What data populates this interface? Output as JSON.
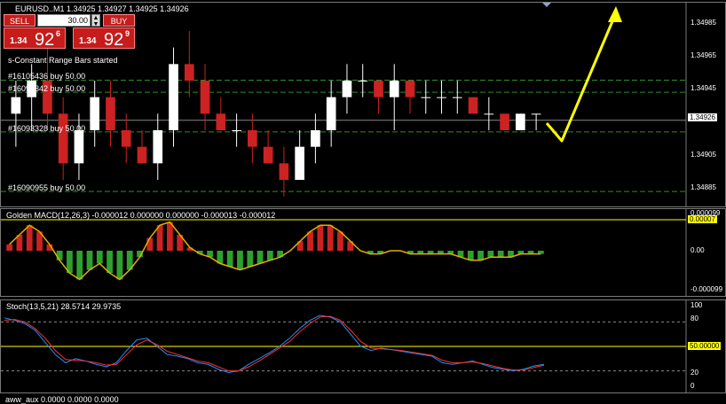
{
  "main_chart": {
    "header": "EURUSD..M1  1.34925 1.34927 1.34925 1.34926",
    "indicator_status": "s-Constant Range Bars started",
    "order_labels": [
      {
        "text": "#16105436 buy 50.00",
        "price": 1.349503
      },
      {
        "text": "#16092342 buy 50.00",
        "price": 1.34943
      },
      {
        "text": "#16093328 buy 50.00",
        "price": 1.34919
      },
      {
        "text": "#16090955 buy 50.00",
        "price": 1.34883
      }
    ],
    "price_axis": [
      "1.34985",
      "1.34965",
      "1.34945",
      "1.34926",
      "1.34905",
      "1.34885"
    ],
    "current_price": "1.34926",
    "candles": [
      [
        1.3493,
        1.3495,
        1.3491,
        1.3494
      ],
      [
        1.3494,
        1.3496,
        1.3492,
        1.3495
      ],
      [
        1.3495,
        1.3497,
        1.3492,
        1.3493
      ],
      [
        1.3493,
        1.3494,
        1.3489,
        1.349
      ],
      [
        1.349,
        1.3493,
        1.3489,
        1.3492
      ],
      [
        1.3492,
        1.3495,
        1.3491,
        1.3494
      ],
      [
        1.3494,
        1.3495,
        1.3491,
        1.3492
      ],
      [
        1.3492,
        1.3493,
        1.349,
        1.3491
      ],
      [
        1.3491,
        1.3492,
        1.349,
        1.349
      ],
      [
        1.349,
        1.3493,
        1.3489,
        1.3492
      ],
      [
        1.3492,
        1.3497,
        1.3491,
        1.3496
      ],
      [
        1.3496,
        1.3498,
        1.3494,
        1.3495
      ],
      [
        1.3495,
        1.3496,
        1.3492,
        1.3493
      ],
      [
        1.3493,
        1.3494,
        1.3492,
        1.3492
      ],
      [
        1.3492,
        1.3493,
        1.3491,
        1.3492
      ],
      [
        1.3492,
        1.3493,
        1.349,
        1.3491
      ],
      [
        1.3491,
        1.3492,
        1.349,
        1.349
      ],
      [
        1.349,
        1.3491,
        1.3488,
        1.3489
      ],
      [
        1.3489,
        1.3492,
        1.3489,
        1.3491
      ],
      [
        1.3491,
        1.3493,
        1.349,
        1.3492
      ],
      [
        1.3492,
        1.3495,
        1.3491,
        1.3494
      ],
      [
        1.3494,
        1.3496,
        1.3493,
        1.3495
      ],
      [
        1.3495,
        1.3496,
        1.3494,
        1.3495
      ],
      [
        1.3495,
        1.3495,
        1.3493,
        1.3494
      ],
      [
        1.3494,
        1.3496,
        1.3492,
        1.3495
      ],
      [
        1.3495,
        1.3495,
        1.3493,
        1.3494
      ],
      [
        1.3494,
        1.3495,
        1.3493,
        1.3494
      ],
      [
        1.3494,
        1.3495,
        1.3493,
        1.3494
      ],
      [
        1.3494,
        1.3495,
        1.3493,
        1.3494
      ],
      [
        1.3494,
        1.3494,
        1.3493,
        1.3493
      ],
      [
        1.3493,
        1.3494,
        1.3492,
        1.3493
      ],
      [
        1.3493,
        1.3493,
        1.3492,
        1.3492
      ],
      [
        1.3492,
        1.3493,
        1.3492,
        1.3493
      ],
      [
        1.3493,
        1.3493,
        1.3492,
        1.3493
      ]
    ]
  },
  "macd": {
    "header": "Golden MACD(12,26,3) -0.000012 0.000000 0.000000 -0.000013 -0.000012",
    "axis_top": "0.000099",
    "axis_zero": "0.00",
    "axis_bottom": "-0.000099",
    "level_value": "0.00007",
    "level_color": "#ffff00",
    "histogram": [
      2,
      5,
      8,
      6,
      2,
      -3,
      -7,
      -9,
      -6,
      -4,
      -7,
      -9,
      -6,
      -2,
      4,
      8,
      9,
      5,
      1,
      -1,
      -2,
      -4,
      -5,
      -6,
      -5,
      -4,
      -3,
      -2,
      0,
      3,
      6,
      8,
      8,
      6,
      3,
      0,
      -1,
      -1,
      0,
      0,
      -1,
      -1,
      -1,
      -1,
      -1,
      -2,
      -3,
      -3,
      -2,
      -2,
      -2,
      -1,
      -1,
      -1
    ]
  },
  "stoch": {
    "header": "Stoch(13,5,21) 28.5714 29.9735",
    "axis": [
      "100",
      "80",
      "20",
      "0"
    ],
    "level_value": "50.00000",
    "level_color": "#ffff00",
    "main": [
      85,
      82,
      78,
      70,
      55,
      40,
      30,
      35,
      32,
      28,
      25,
      30,
      45,
      58,
      60,
      50,
      40,
      38,
      35,
      30,
      28,
      22,
      18,
      20,
      28,
      35,
      42,
      50,
      60,
      72,
      82,
      88,
      86,
      80,
      65,
      50,
      45,
      48,
      46,
      44,
      42,
      40,
      38,
      30,
      28,
      30,
      32,
      28,
      24,
      22,
      20,
      22,
      26,
      28
    ],
    "signal": [
      82,
      83,
      80,
      72,
      60,
      45,
      34,
      33,
      32,
      30,
      27,
      28,
      40,
      52,
      58,
      52,
      44,
      40,
      36,
      32,
      30,
      25,
      20,
      20,
      25,
      32,
      40,
      48,
      56,
      68,
      78,
      86,
      87,
      82,
      70,
      56,
      48,
      47,
      46,
      45,
      43,
      41,
      39,
      33,
      30,
      30,
      31,
      29,
      26,
      23,
      21,
      21,
      24,
      27
    ]
  },
  "bottom_header": "aww_aux 0.0000 0.0000 0.0000",
  "trade_widget": {
    "sell_label": "SELL",
    "buy_label": "BUY",
    "lot_value": "30.00",
    "sell_price_prefix": "1.34",
    "sell_price_big": "92",
    "sell_price_sup": "6",
    "buy_price_prefix": "1.34",
    "buy_price_big": "92",
    "buy_price_sup": "9",
    "color": "#c61c1c"
  },
  "colors": {
    "up": "#ffffff",
    "down": "#cc2222",
    "order_line": "#2e8b2e",
    "drawing_arrow": "#ffff00",
    "macd_pos": "#cc2222",
    "macd_neg": "#2fa02f",
    "stoch_main": "#1e90ff",
    "stoch_signal": "#ff3030"
  },
  "price_range": [
    1.34875,
    1.34995
  ]
}
